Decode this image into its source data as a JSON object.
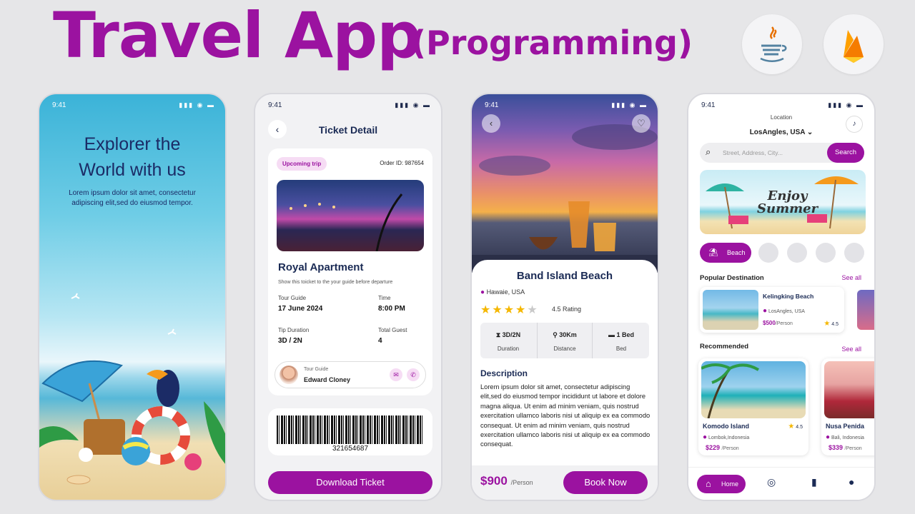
{
  "headline": {
    "title": "Travel App",
    "subtitle": "(Programming)",
    "badge_icons": [
      "java-icon",
      "firebase-icon"
    ]
  },
  "status": {
    "time": "9:41",
    "icons": "▮▮▮ ◉ ▬"
  },
  "onboarding": {
    "title_line1": "Explorer the",
    "title_line2": "World with us",
    "text": "Lorem ipsum dolor sit amet, consectetur adipiscing elit,sed do eiusmod tempor."
  },
  "ticket": {
    "back": "‹",
    "title": "Ticket Detail",
    "badge": "Upcoming trip",
    "order_id": "Order ID: 987654",
    "place": "Royal Apartment",
    "note": "Show this toicket to the your guide before departure",
    "tour_guide_label": "Tour Guide",
    "tour_guide_date": "17 June 2024",
    "time_label": "Time",
    "time_value": "8:00 PM",
    "duration_label": "Tip Duration",
    "duration_value": "3D / 2N",
    "guest_label": "Total Guest",
    "guest_value": "4",
    "guide_label": "Tour Guide",
    "guide_name": "Edward Cloney",
    "barcode_number": "321654687",
    "download": "Download Ticket"
  },
  "detail": {
    "back": "‹",
    "fav": "♡",
    "name": "Band Island Beach",
    "location": "Hawaie, USA",
    "rating_text": "4.5 Rating",
    "stars_filled": 4,
    "stars_total": 5,
    "stats": [
      {
        "value": "3D/2N",
        "label": "Duration",
        "icon": "hourglass-icon"
      },
      {
        "value": "30Km",
        "label": "Distance",
        "icon": "route-icon"
      },
      {
        "value": "1 Bed",
        "label": "Bed",
        "icon": "bed-icon"
      }
    ],
    "desc_title": "Description",
    "desc_text": "Lorem ipsum dolor sit amet, consectetur adipiscing elit,sed do eiusmod tempor incididunt ut labore et dolore magna aliqua. Ut enim ad minim veniam, quis nostrud exercitation ullamco laboris nisi ut aliquip ex ea commodo consequat. Ut enim ad minim veniam, quis nostrud exercitation ullamco laboris nisi ut aliquip ex ea commodo consequat.",
    "price": "$900",
    "per": "/Person",
    "book": "Book Now"
  },
  "home": {
    "location_label": "Location",
    "location_value": "LosAngles, USA ⌄",
    "search_placeholder": "Street, Address, City...",
    "search_button": "Search",
    "banner_line1": "Enjoy",
    "banner_line2": "Summer",
    "category_active": "Beach",
    "popular_title": "Popular Destination",
    "see_all": "See all",
    "popular": {
      "name": "Kelingking Beach",
      "location": "LosAngles, USA",
      "price": "$500",
      "per": "/Person",
      "rating": "4.5"
    },
    "recommended_title": "Recommended",
    "recommended": [
      {
        "name": "Komodo Island",
        "location": "Lombok,Indonesia",
        "price": "$229",
        "per": "/Person",
        "rating": "4.5"
      },
      {
        "name": "Nusa Penida",
        "location": "Bali, Indonesia",
        "price": "$339",
        "per": "/Person"
      }
    ],
    "nav": {
      "home": "Home"
    }
  },
  "colors": {
    "brand": "#9b12a0",
    "navy": "#1b2b55",
    "star": "#f5b700",
    "background": "#e6e6e8"
  }
}
